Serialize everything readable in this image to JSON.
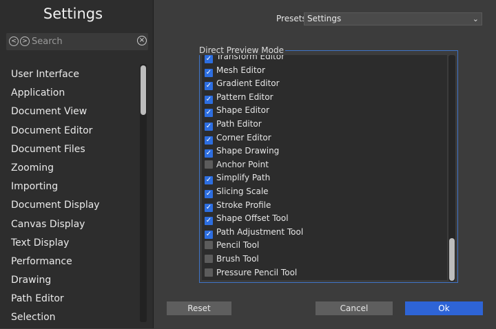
{
  "sidebar": {
    "title": "Settings",
    "search_placeholder": "Search",
    "back_glyph": "<",
    "forward_glyph": ">",
    "clear_glyph": "×",
    "items": [
      "User Interface",
      "Application",
      "Document View",
      "Document Editor",
      "Document Files",
      "Zooming",
      "Importing",
      "Document Display",
      "Canvas Display",
      "Text Display",
      "Performance",
      "Drawing",
      "Path Editor",
      "Selection"
    ]
  },
  "presets": {
    "label": "Presets",
    "value": "Settings",
    "chevron": "⌄"
  },
  "group": {
    "title": "Direct Preview Mode",
    "items": [
      {
        "label": "Transform Editor",
        "checked": true
      },
      {
        "label": "Mesh Editor",
        "checked": true
      },
      {
        "label": "Gradient Editor",
        "checked": true
      },
      {
        "label": "Pattern Editor",
        "checked": true
      },
      {
        "label": "Shape Editor",
        "checked": true
      },
      {
        "label": "Path Editor",
        "checked": true
      },
      {
        "label": "Corner Editor",
        "checked": true
      },
      {
        "label": "Shape Drawing",
        "checked": true
      },
      {
        "label": "Anchor Point",
        "checked": false
      },
      {
        "label": "Simplify Path",
        "checked": true
      },
      {
        "label": "Slicing Scale",
        "checked": true
      },
      {
        "label": "Stroke Profile",
        "checked": true
      },
      {
        "label": "Shape Offset Tool",
        "checked": true
      },
      {
        "label": "Path Adjustment Tool",
        "checked": true
      },
      {
        "label": "Pencil Tool",
        "checked": false
      },
      {
        "label": "Brush Tool",
        "checked": false
      },
      {
        "label": "Pressure Pencil Tool",
        "checked": false
      }
    ]
  },
  "buttons": {
    "reset": "Reset",
    "cancel": "Cancel",
    "ok": "Ok"
  },
  "colors": {
    "accent": "#2e64d6",
    "group_border": "#3f74c8",
    "checkbox_on": "#2d6ee0"
  }
}
